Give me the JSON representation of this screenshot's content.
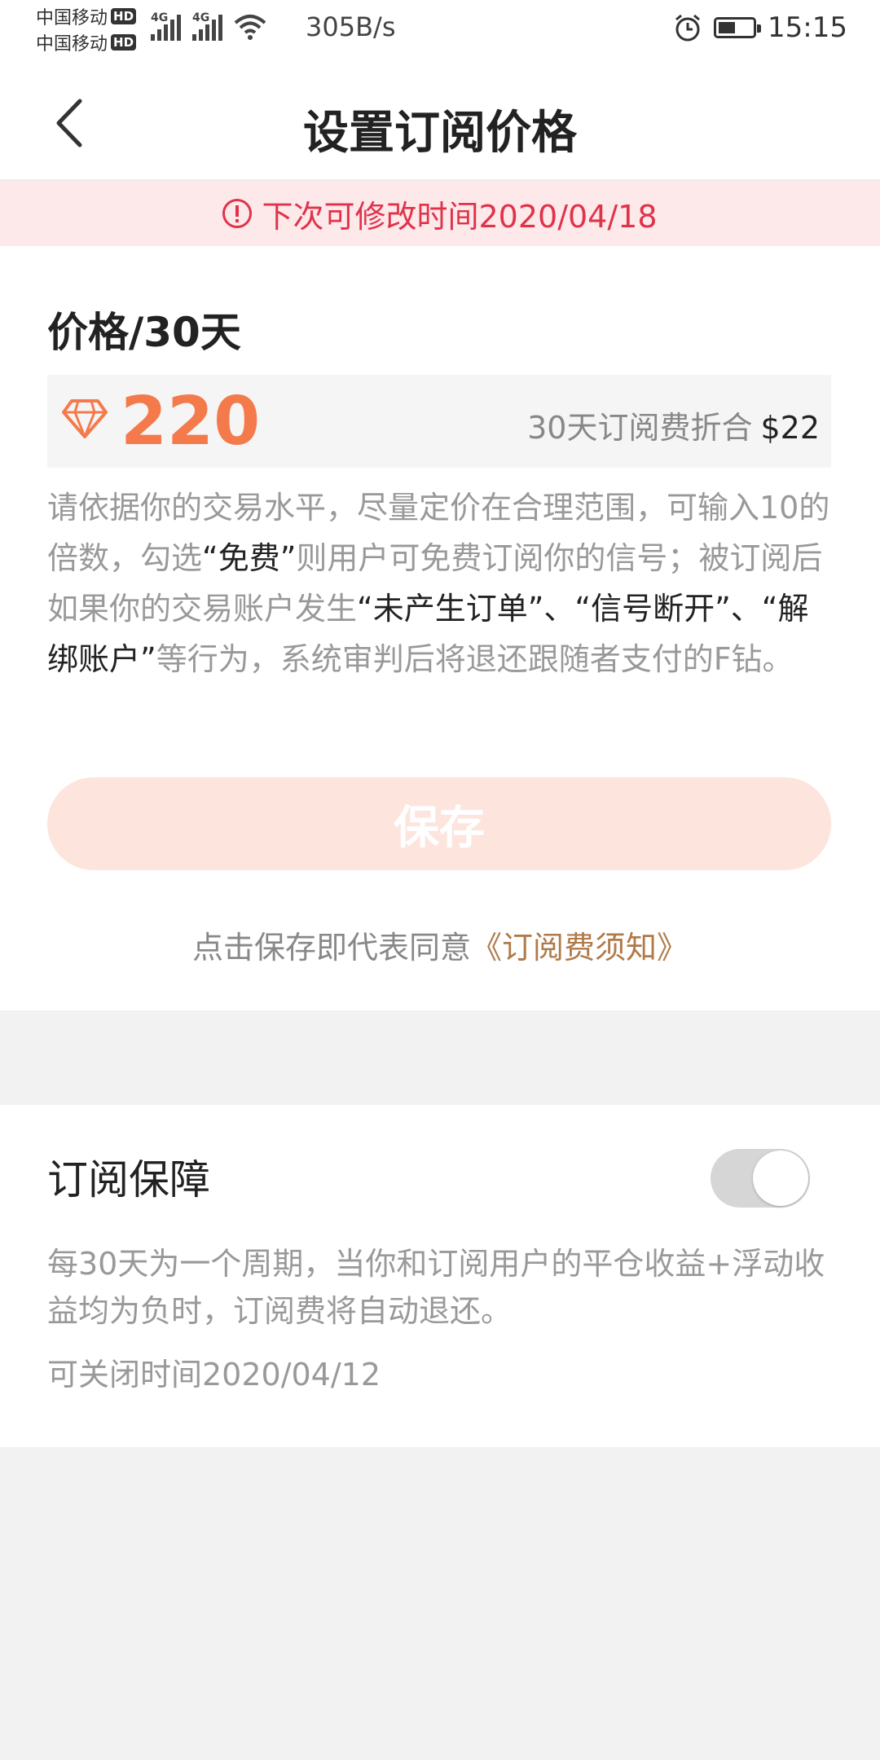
{
  "status_bar": {
    "carrier1": "中国移动",
    "carrier2": "中国移动",
    "hd_badge": "HD",
    "network_tag": "4G",
    "net_speed": "305B/s",
    "time": "15:15",
    "icons": [
      "signal-icon",
      "wifi-icon",
      "alarm-icon",
      "battery-icon"
    ]
  },
  "header": {
    "title": "设置订阅价格",
    "back_icon": "chevron-left-icon"
  },
  "notice": {
    "text": "下次可修改时间2020/04/18",
    "color": "#e0334a"
  },
  "price": {
    "label": "价格/30天",
    "value": "220",
    "conversion_text": "30天订阅费折合",
    "conversion_amount": "$22",
    "accent_color": "#f47a4c"
  },
  "description": {
    "part1": "请依据你的交易水平，尽量定价在合理范围，可输入10的倍数，勾选",
    "free": "“免费”",
    "part2": "则用户可免费订阅你的信号；被订阅后如果你的交易账户发生",
    "cases": "“未产生订单”、“信号断开”、“解绑账户”",
    "part3": "等行为，系统审判后将退还跟随者支付的F钻。"
  },
  "save_button": {
    "label": "保存"
  },
  "agreement": {
    "prefix": "点击保存即代表同意",
    "link": "《订阅费须知》"
  },
  "guarantee": {
    "title": "订阅保障",
    "toggle_on": false,
    "description": "每30天为一个周期，当你和订阅用户的平仓收益+浮动收益均为负时，订阅费将自动退还。",
    "close_time": "可关闭时间2020/04/12"
  }
}
